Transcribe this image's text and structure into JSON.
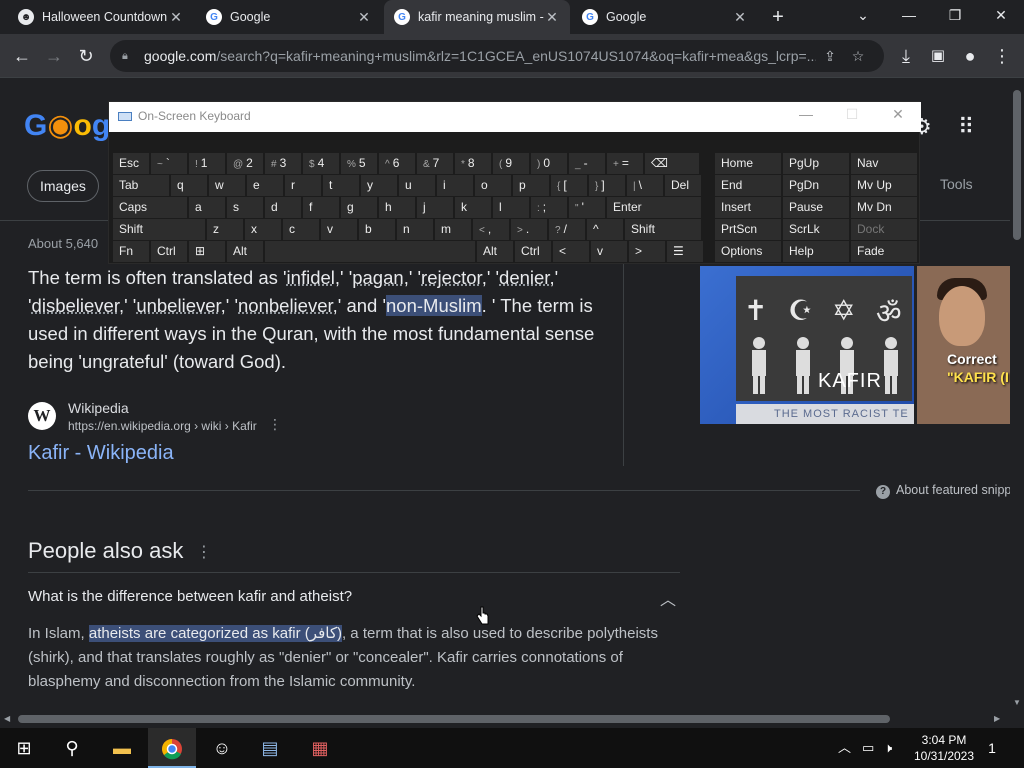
{
  "tabs": [
    {
      "title": "Halloween Countdown",
      "icon": "halloween-favicon"
    },
    {
      "title": "Google",
      "icon": "google-favicon"
    },
    {
      "title": "kafir meaning muslim - ...",
      "icon": "google-favicon"
    },
    {
      "title": "Google",
      "icon": "google-favicon"
    }
  ],
  "address": {
    "host": "google.com",
    "path": "/search?q=kafir+meaning+muslim&rlz=1C1GCEA_enUS1074US1074&oq=kafir+mea&gs_lcrp=..."
  },
  "google": {
    "logo_text": "Google",
    "chip_images": "Images",
    "tools": "Tools",
    "result_count": "About 5,640",
    "snippet": {
      "p1": "The term is often translated as '",
      "w1": "infidel",
      "p2": ",' '",
      "w2": "pagan",
      "p3": ",' '",
      "w3": "rejector",
      "p4": ",' '",
      "w4": "denier",
      "p5": ",' '",
      "w5": "disbeliever",
      "p6": ",' '",
      "w6": "unbeliever",
      "p7": ",' '",
      "w7": "nonbeliever",
      "p8": ",' and '",
      "highlight": "non-Muslim",
      "p9": ". ' The term is used in different ways in the Quran, with the most fundamental sense being 'ungrateful' (toward God)."
    },
    "source": {
      "icon_letter": "W",
      "name": "Wikipedia",
      "url": "https://en.wikipedia.org › wiki › Kafir",
      "link": "Kafir - Wikipedia"
    },
    "featured_label": "About featured snipp",
    "image_text": {
      "kafir": "KAFIR",
      "band": "THE MOST RACIST TE",
      "video_caption_1": "Correct",
      "video_caption_2": "\"KAFIR (I"
    },
    "paa": {
      "title": "People also ask",
      "question": "What is the difference between kafir and atheist?",
      "answer_pre": "In Islam, ",
      "answer_highlight": "atheists are categorized as kafir (كافر)",
      "answer_post": ", a term that is also used to describe polytheists (shirk), and that translates roughly as \"denier\" or \"concealer\". Kafir carries connotations of blasphemy and disconnection from the Islamic community."
    }
  },
  "osk": {
    "title": "On-Screen Keyboard",
    "rows": [
      [
        {
          "main": "Esc"
        },
        {
          "sup": "~",
          "main": "`"
        },
        {
          "sup": "!",
          "main": "1"
        },
        {
          "sup": "@",
          "main": "2"
        },
        {
          "sup": "#",
          "main": "3"
        },
        {
          "sup": "$",
          "main": "4"
        },
        {
          "sup": "%",
          "main": "5"
        },
        {
          "sup": "^",
          "main": "6"
        },
        {
          "sup": "&",
          "main": "7"
        },
        {
          "sup": "*",
          "main": "8"
        },
        {
          "sup": "(",
          "main": "9"
        },
        {
          "sup": ")",
          "main": "0"
        },
        {
          "sup": "_",
          "main": "-"
        },
        {
          "sup": "+",
          "main": "="
        },
        {
          "main": "⌫"
        }
      ],
      [
        {
          "main": "Tab"
        },
        {
          "main": "q"
        },
        {
          "main": "w"
        },
        {
          "main": "e"
        },
        {
          "main": "r"
        },
        {
          "main": "t"
        },
        {
          "main": "y"
        },
        {
          "main": "u"
        },
        {
          "main": "i"
        },
        {
          "main": "o"
        },
        {
          "main": "p"
        },
        {
          "sup": "{",
          "main": "["
        },
        {
          "sup": "}",
          "main": "]"
        },
        {
          "sup": "|",
          "main": "\\"
        },
        {
          "main": "Del"
        }
      ],
      [
        {
          "main": "Caps"
        },
        {
          "main": "a"
        },
        {
          "main": "s"
        },
        {
          "main": "d"
        },
        {
          "main": "f"
        },
        {
          "main": "g"
        },
        {
          "main": "h"
        },
        {
          "main": "j"
        },
        {
          "main": "k"
        },
        {
          "main": "l"
        },
        {
          "sup": ":",
          "main": ";"
        },
        {
          "sup": "\"",
          "main": "'"
        },
        {
          "main": "Enter"
        }
      ],
      [
        {
          "main": "Shift"
        },
        {
          "main": "z"
        },
        {
          "main": "x"
        },
        {
          "main": "c"
        },
        {
          "main": "v"
        },
        {
          "main": "b"
        },
        {
          "main": "n"
        },
        {
          "main": "m"
        },
        {
          "sup": "<",
          "main": ","
        },
        {
          "sup": ">",
          "main": "."
        },
        {
          "sup": "?",
          "main": "/"
        },
        {
          "main": "^"
        },
        {
          "main": "Shift"
        }
      ],
      [
        {
          "main": "Fn"
        },
        {
          "main": "Ctrl"
        },
        {
          "main": "⊞"
        },
        {
          "main": "Alt"
        },
        {
          "main": ""
        },
        {
          "main": "Alt"
        },
        {
          "main": "Ctrl"
        },
        {
          "main": "<"
        },
        {
          "main": "v"
        },
        {
          "main": ">"
        },
        {
          "main": "☰"
        }
      ]
    ],
    "nav": [
      [
        "Home",
        "PgUp",
        "Nav"
      ],
      [
        "End",
        "PgDn",
        "Mv Up"
      ],
      [
        "Insert",
        "Pause",
        "Mv Dn"
      ],
      [
        "PrtScn",
        "ScrLk",
        "Dock"
      ],
      [
        "Options",
        "Help",
        "Fade"
      ]
    ]
  },
  "taskbar": {
    "time": "3:04 PM",
    "date": "10/31/2023",
    "notifications": "1"
  }
}
